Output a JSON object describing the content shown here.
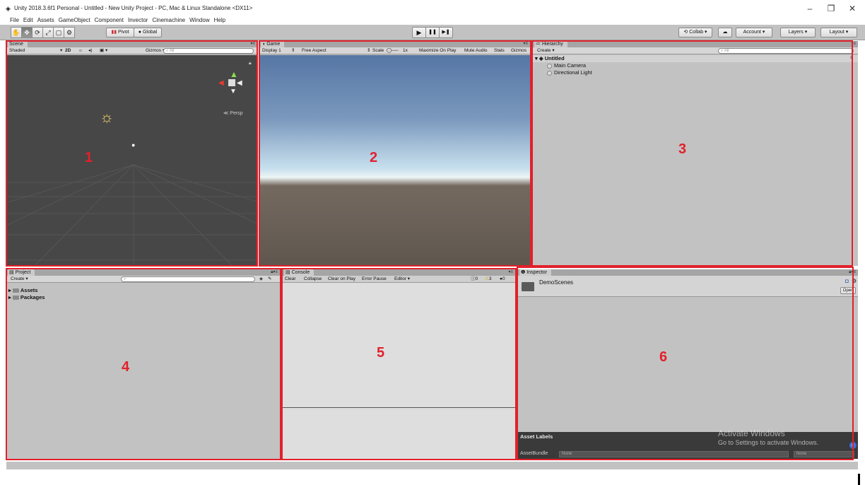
{
  "window": {
    "title": "Unity 2018.3.6f1 Personal - Untitled - New Unity Project - PC, Mac & Linux Standalone <DX11>",
    "minimize": "–",
    "restore": "❐",
    "close": "✕"
  },
  "menu": [
    "File",
    "Edit",
    "Assets",
    "GameObject",
    "Component",
    "Invector",
    "Cinemachine",
    "Window",
    "Help"
  ],
  "toolbar": {
    "tools": [
      "✋",
      "✥",
      "⟳",
      "⤢",
      "▢",
      "⚙"
    ],
    "pivot": "Pivot",
    "global": "Global",
    "play": "▶",
    "pause": "❚❚",
    "step": "▶❚",
    "collab": "Collab ▾",
    "cloud": "☁",
    "account": "Account ▾",
    "layers": "Layers ▾",
    "layout": "Layout ▾"
  },
  "scene": {
    "tab": "Scene",
    "shaded": "Shaded",
    "mode2d": "2D",
    "gizmos": "Gizmos ▾",
    "search_placeholder": "All",
    "persp": "Persp",
    "annotation": "1"
  },
  "game": {
    "tab": "Game",
    "display": "Display 1",
    "aspect": "Free Aspect",
    "scale_label": "Scale",
    "scale_value": "1x",
    "maximize": "Maximize On Play",
    "mute": "Mute Audio",
    "stats": "Stats",
    "gizmos": "Gizmos",
    "annotation": "2"
  },
  "hierarchy": {
    "tab": "Hierarchy",
    "create": "Create ▾",
    "search_placeholder": "All",
    "scene": "Untitled",
    "items": [
      "Main Camera",
      "Directional Light"
    ],
    "annotation": "3"
  },
  "project": {
    "tab": "Project",
    "create": "Create ▾",
    "folders": [
      "Assets",
      "Packages"
    ],
    "annotation": "4"
  },
  "console": {
    "tab": "Console",
    "buttons": [
      "Clear",
      "Collapse",
      "Clear on Play",
      "Error Pause",
      "Editor ▾"
    ],
    "info_count": "0",
    "warning_count": "3",
    "error_count": "0",
    "annotation": "5"
  },
  "inspector": {
    "tab": "Inspector",
    "object_name": "DemoScenes",
    "open_button": "Open",
    "asset_labels": "Asset Labels",
    "asset_bundle_label": "AssetBundle",
    "asset_bundle_value": "None",
    "asset_bundle_variant": "None",
    "annotation": "6"
  },
  "watermark": {
    "title": "Activate Windows",
    "subtitle": "Go to Settings to activate Windows."
  },
  "colors": {
    "annotation_red": "#e2202b",
    "panel_bg": "#c2c2c2",
    "scene_bg": "#454545"
  }
}
